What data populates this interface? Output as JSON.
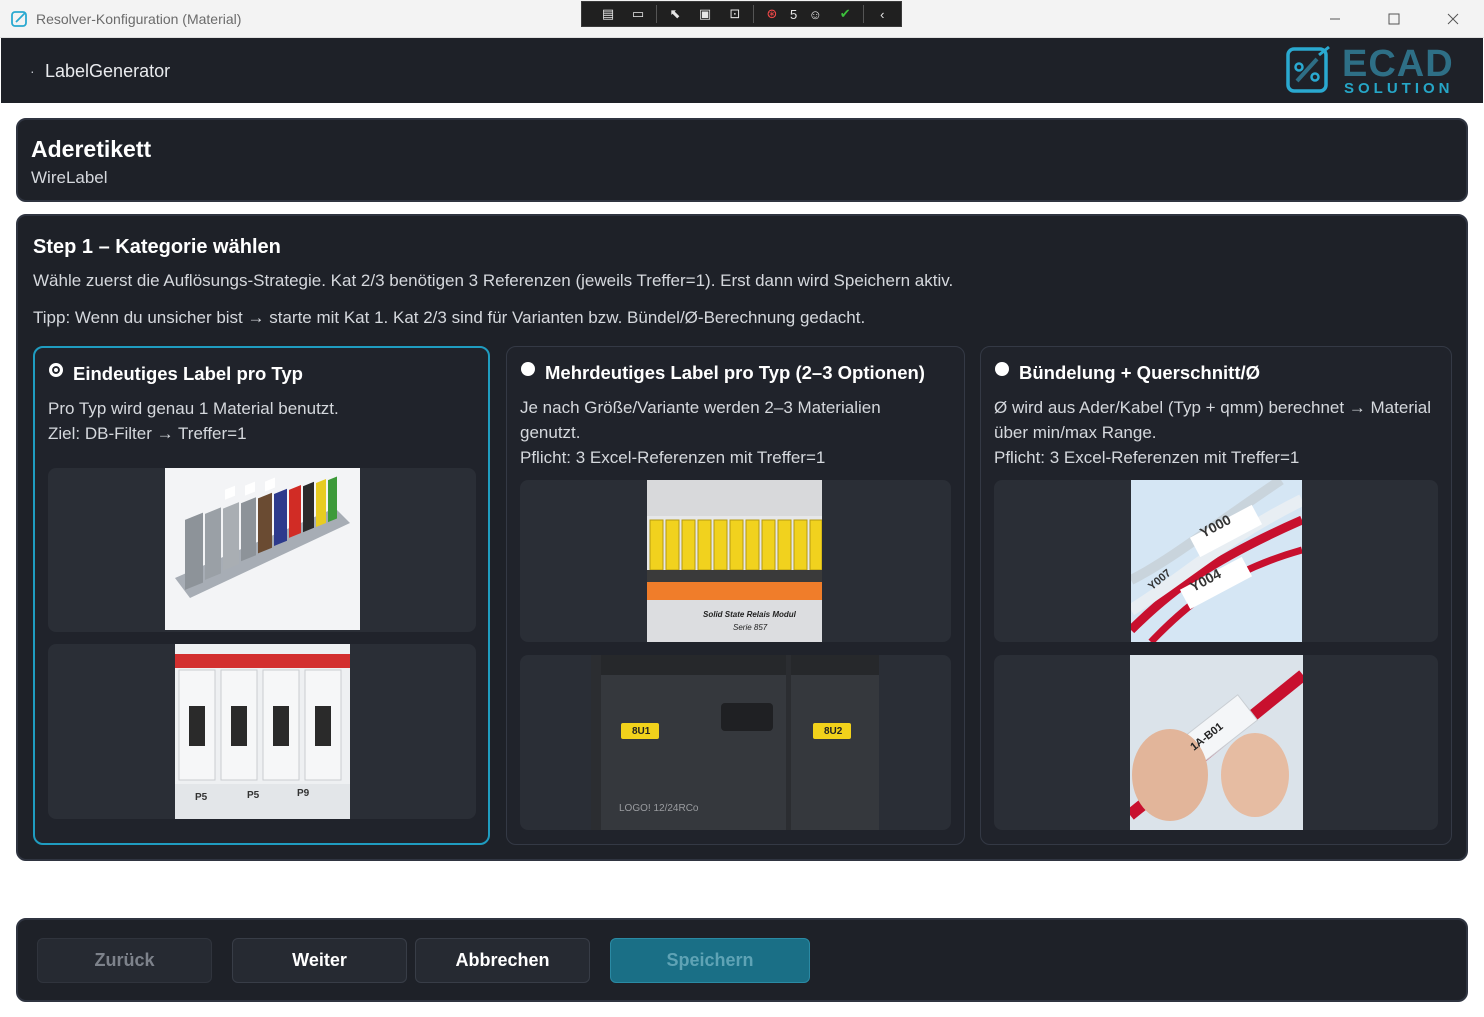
{
  "window": {
    "title": "Resolver-Konfiguration (Material)",
    "debug_toolbar_count": "5"
  },
  "header": {
    "breadcrumb": "LabelGenerator",
    "logo_main": "ECAD",
    "logo_sub": "SOLUTION"
  },
  "label_header": {
    "title": "Aderetikett",
    "subtitle": "WireLabel"
  },
  "step": {
    "title": "Step 1 – Kategorie wählen",
    "description": "Wähle zuerst die Auflösungs-Strategie. Kat 2/3 benötigen 3 Referenzen (jeweils Treffer=1). Erst dann wird Speichern aktiv.",
    "tip": "Tipp: Wenn du unsicher bist → starte mit Kat 1. Kat 2/3 sind für Varianten bzw. Bündel/Ø-Berechnung gedacht.",
    "options": [
      {
        "title": "Eindeutiges Label pro Typ",
        "text": "Pro Typ wird genau 1 Material benutzt.\nZiel: DB-Filter → Treffer=1",
        "selected": true
      },
      {
        "title": "Mehrdeutiges Label pro Typ (2–3 Optionen)",
        "text": "Je nach Größe/Variante werden 2–3 Materialien genutzt.\nPflicht: 3 Excel-Referenzen mit Treffer=1",
        "selected": false
      },
      {
        "title": "Bündelung + Querschnitt/Ø",
        "text": "Ø wird aus Ader/Kabel (Typ + qmm) berechnet → Material über min/max Range.\nPflicht: 3 Excel-Referenzen mit Treffer=1",
        "selected": false
      }
    ]
  },
  "photo_text": {
    "p5a": "P5",
    "p5b": "P5",
    "p9": "P9",
    "relay_label": "Solid State Relais Modul",
    "relay_series": "Serie 857",
    "plc_8u1": "8U1",
    "plc_8u2": "8U2",
    "plc_logo": "LOGO! 12/24RCo",
    "wire_y000": "Y000",
    "wire_y004": "Y004",
    "wire_y007": "Y007",
    "wire_1a": "1A-B01"
  },
  "footer": {
    "back": "Zurück",
    "next": "Weiter",
    "cancel": "Abbrechen",
    "save": "Speichern"
  },
  "colors": {
    "accent": "#1f9cc0",
    "panel_bg": "#1e2128",
    "save_bg": "#1a6f86"
  }
}
